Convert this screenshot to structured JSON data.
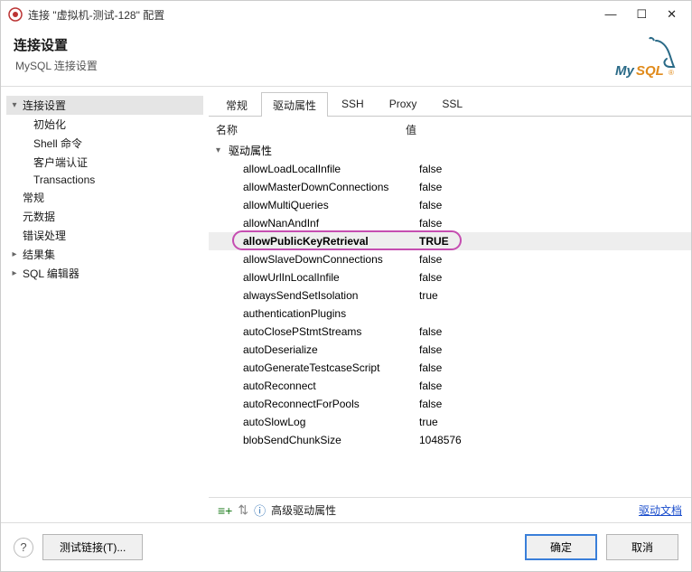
{
  "window": {
    "title": "连接 \"虚拟机-测试-128\" 配置",
    "minimize": "—",
    "maximize": "☐",
    "close": "✕"
  },
  "header": {
    "title": "连接设置",
    "subtitle": "MySQL 连接设置"
  },
  "sidebar": {
    "root": {
      "label": "连接设置",
      "children": [
        {
          "label": "初始化"
        },
        {
          "label": "Shell 命令"
        },
        {
          "label": "客户端认证"
        },
        {
          "label": "Transactions"
        }
      ]
    },
    "items2": [
      {
        "label": "常规"
      },
      {
        "label": "元数据"
      },
      {
        "label": "错误处理"
      }
    ],
    "items3": [
      {
        "label": "结果集",
        "collapsed": true
      },
      {
        "label": "SQL 编辑器",
        "collapsed": true
      }
    ]
  },
  "tabs": [
    {
      "label": "常规",
      "active": false
    },
    {
      "label": "驱动属性",
      "active": true
    },
    {
      "label": "SSH",
      "active": false
    },
    {
      "label": "Proxy",
      "active": false
    },
    {
      "label": "SSL",
      "active": false
    }
  ],
  "prop_headers": {
    "name": "名称",
    "value": "值"
  },
  "prop_group": "驱动属性",
  "properties": [
    {
      "name": "allowLoadLocalInfile",
      "value": "false"
    },
    {
      "name": "allowMasterDownConnections",
      "value": "false"
    },
    {
      "name": "allowMultiQueries",
      "value": "false"
    },
    {
      "name": "allowNanAndInf",
      "value": "false"
    },
    {
      "name": "allowPublicKeyRetrieval",
      "value": "TRUE",
      "highlight": true
    },
    {
      "name": "allowSlaveDownConnections",
      "value": "false"
    },
    {
      "name": "allowUrlInLocalInfile",
      "value": "false"
    },
    {
      "name": "alwaysSendSetIsolation",
      "value": "true"
    },
    {
      "name": "authenticationPlugins",
      "value": ""
    },
    {
      "name": "autoClosePStmtStreams",
      "value": "false"
    },
    {
      "name": "autoDeserialize",
      "value": "false"
    },
    {
      "name": "autoGenerateTestcaseScript",
      "value": "false"
    },
    {
      "name": "autoReconnect",
      "value": "false"
    },
    {
      "name": "autoReconnectForPools",
      "value": "false"
    },
    {
      "name": "autoSlowLog",
      "value": "true"
    },
    {
      "name": "blobSendChunkSize",
      "value": "1048576"
    }
  ],
  "prop_footer": {
    "add_label": "",
    "advanced": "高级驱动属性",
    "link": "驱动文档"
  },
  "footer": {
    "test": "测试链接(T)...",
    "ok": "确定",
    "cancel": "取消"
  }
}
